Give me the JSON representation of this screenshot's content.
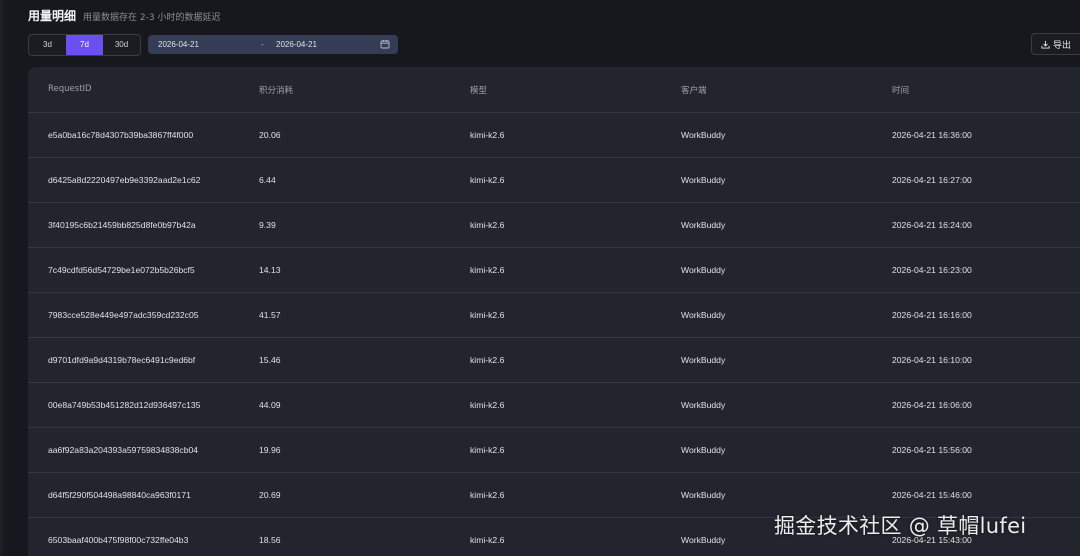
{
  "header": {
    "title": "用量明细",
    "subtitle": "用量数据存在 2-3 小时的数据延迟"
  },
  "toolbar": {
    "ranges": [
      "3d",
      "7d",
      "30d"
    ],
    "active_range": "7d",
    "date_start": "2026-04-21",
    "date_separator": "-",
    "date_end": "2026-04-21",
    "export_label": "导出"
  },
  "table": {
    "columns": [
      "RequestID",
      "积分消耗",
      "模型",
      "客户端",
      "时间"
    ],
    "rows": [
      [
        "e5a0ba16c78d4307b39ba3867ff4f000",
        "20.06",
        "kimi-k2.6",
        "WorkBuddy",
        "2026-04-21 16:36:00"
      ],
      [
        "d6425a8d2220497eb9e3392aad2e1c62",
        "6.44",
        "kimi-k2.6",
        "WorkBuddy",
        "2026-04-21 16:27:00"
      ],
      [
        "3f40195c6b21459bb825d8fe0b97b42a",
        "9.39",
        "kimi-k2.6",
        "WorkBuddy",
        "2026-04-21 16:24:00"
      ],
      [
        "7c49cdfd56d54729be1e072b5b26bcf5",
        "14.13",
        "kimi-k2.6",
        "WorkBuddy",
        "2026-04-21 16:23:00"
      ],
      [
        "7983cce528e449e497adc359cd232c05",
        "41.57",
        "kimi-k2.6",
        "WorkBuddy",
        "2026-04-21 16:16:00"
      ],
      [
        "d9701dfd9a9d4319b78ec6491c9ed6bf",
        "15.46",
        "kimi-k2.6",
        "WorkBuddy",
        "2026-04-21 16:10:00"
      ],
      [
        "00e8a749b53b451282d12d936497c135",
        "44.09",
        "kimi-k2.6",
        "WorkBuddy",
        "2026-04-21 16:06:00"
      ],
      [
        "aa6f92a83a204393a59759834838cb04",
        "19.96",
        "kimi-k2.6",
        "WorkBuddy",
        "2026-04-21 15:56:00"
      ],
      [
        "d64f5f290f504498a98840ca963f0171",
        "20.69",
        "kimi-k2.6",
        "WorkBuddy",
        "2026-04-21 15:46:00"
      ],
      [
        "6503baaf400b475f98f00c732ffe04b3",
        "18.56",
        "kimi-k2.6",
        "WorkBuddy",
        "2026-04-21 15:43:00"
      ]
    ]
  },
  "watermark": "掘金技术社区 @ 草帽lufei",
  "colors": {
    "accent": "#6b4ff0",
    "background": "#17181d",
    "card": "#23252e",
    "date_picker": "#353c55"
  },
  "icons": {
    "calendar": "calendar-icon",
    "export": "download-icon"
  }
}
